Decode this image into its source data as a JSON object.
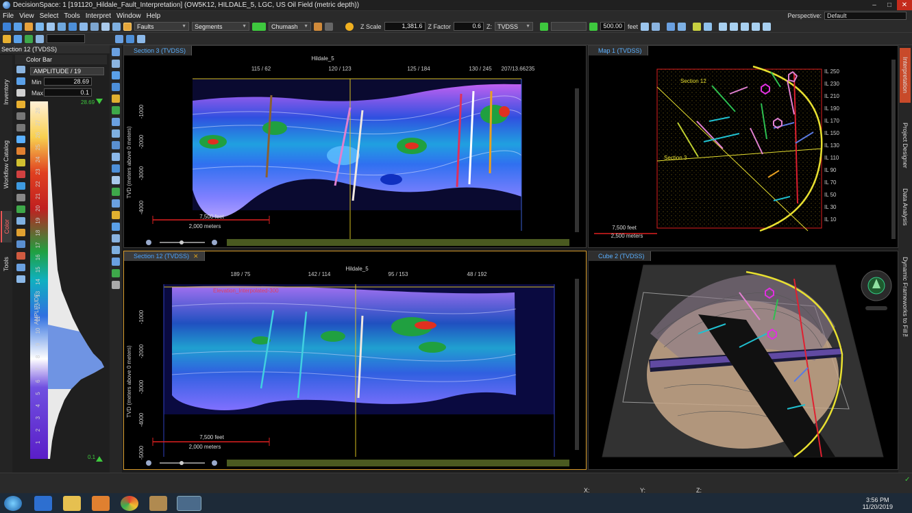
{
  "window": {
    "title": "DecisionSpace: 1 [191120_Hildale_Fault_Interpretation] (OW5K12, HILDALE_5, LGC, US Oil Field (metric depth))"
  },
  "menu": [
    "File",
    "View",
    "Select",
    "Tools",
    "Interpret",
    "Window",
    "Help"
  ],
  "perspective": {
    "label": "Perspective:",
    "value": "Default"
  },
  "toolbar": {
    "faults": "Faults",
    "segments": "Segments",
    "colormap": "Chumash",
    "zscale_label": "Z Scale",
    "zscale_value": "1,381.6",
    "zfactor_label": "Z Factor",
    "zfactor_value": "0.6",
    "z_label": "Z:",
    "z_domain": "TVDSS",
    "depth_value": "500.00",
    "depth_unit": "feet"
  },
  "side_tabs": [
    "Inventory",
    "Workflow Catalog",
    "Color",
    "Tools"
  ],
  "left_panel": {
    "title": "Section 12 (TVDSS)",
    "colorbar_title": "Color Bar",
    "attribute": "AMPLITUDE / 19",
    "min_label": "Min",
    "min_value": "28.69",
    "max_label": "Max",
    "max_value": "0.1",
    "top_value": "28.69",
    "bottom_value": "0.1",
    "axis_label": "AMPLITUDE",
    "ticks": [
      "28",
      "27",
      "26",
      "25",
      "24",
      "23",
      "22",
      "21",
      "20",
      "19",
      "18",
      "17",
      "16",
      "15",
      "14",
      "13",
      "12",
      "11",
      "10",
      "9",
      "8",
      "7",
      "6",
      "5",
      "4",
      "3",
      "2",
      "1"
    ]
  },
  "section3": {
    "title": "Section 3 (TVDSS)",
    "well": "Hildale_5",
    "top_labels": [
      "115 / 62",
      "120 / 123",
      "125 / 184",
      "130 / 245",
      "207/13.66235"
    ],
    "depth_labels": [
      "-1000",
      "-2000",
      "-3000",
      "-4000"
    ],
    "axis_title": "TVD (meters above 0 meters)",
    "scale_feet": "7,500 feet",
    "scale_meters": "2,000 meters"
  },
  "section12": {
    "title": "Section 12 (TVDSS)",
    "well": "Hildale_5",
    "horizon_label": "Elevation_Interpolated-300",
    "top_labels": [
      "189 / 75",
      "142 / 114",
      "95 / 153",
      "48 / 192"
    ],
    "depth_labels": [
      "-1000",
      "-2000",
      "-3000",
      "-4000",
      "-5000"
    ],
    "axis_title": "TVD (meters above 0 meters)",
    "scale_feet": "7,500 feet",
    "scale_meters": "2,000 meters"
  },
  "map1": {
    "title": "Map 1 (TVDSS)",
    "il_labels": [
      "IL 250",
      "IL 230",
      "IL 210",
      "IL 190",
      "IL 170",
      "IL 150",
      "IL 130",
      "IL 110",
      "IL 90",
      "IL 70",
      "IL 50",
      "IL 30",
      "IL 10"
    ],
    "section12_label": "Section 12",
    "section3_label": "Section 3",
    "scale_feet": "7,500 feet",
    "scale_meters": "2,500 meters"
  },
  "cube2": {
    "title": "Cube 2 (TVDSS)"
  },
  "right_tabs": [
    "Interpretation",
    "Project Designer",
    "Data Analysis",
    "Dynamic Frameworks to Fill™"
  ],
  "status": {
    "x": "X:",
    "y": "Y:",
    "z": "Z:"
  },
  "clock": {
    "time": "3:56 PM",
    "date": "11/20/2019"
  },
  "colors": {
    "accent": "#d89b2a",
    "tab_blue": "#4aa3ff",
    "map_yellow": "#e6d21e"
  }
}
